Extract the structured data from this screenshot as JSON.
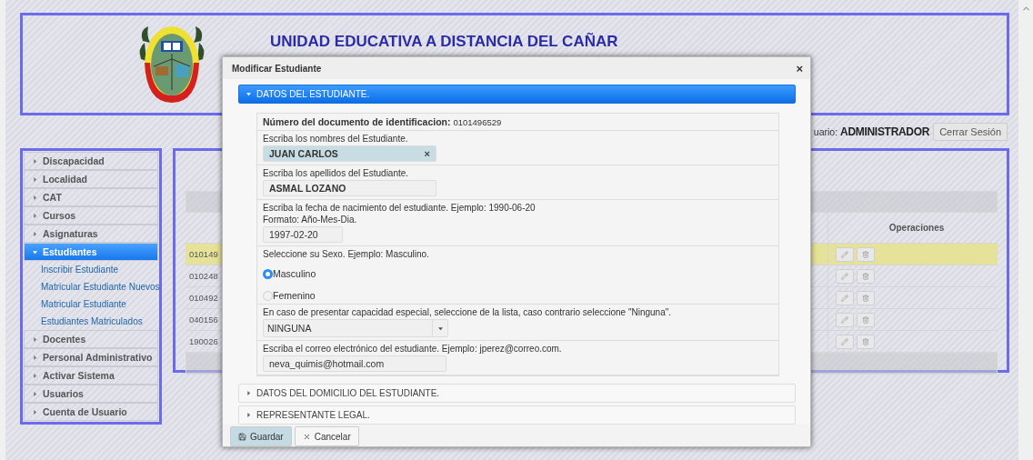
{
  "header": {
    "title": "UNIDAD EDUCATIVA A DISTANCIA DEL CAÑAR"
  },
  "user_bar": {
    "label": "uario:",
    "user": "ADMINISTRADOR",
    "logout": "Cerrar Sesión"
  },
  "sidebar": {
    "items": [
      {
        "label": "Discapacidad",
        "expanded": false,
        "selected": false
      },
      {
        "label": "Localidad",
        "expanded": false,
        "selected": false
      },
      {
        "label": "CAT",
        "expanded": false,
        "selected": false
      },
      {
        "label": "Cursos",
        "expanded": false,
        "selected": false
      },
      {
        "label": "Asignaturas",
        "expanded": false,
        "selected": false
      },
      {
        "label": "Estudiantes",
        "expanded": true,
        "selected": true,
        "children": [
          {
            "label": "Inscribir Estudiante"
          },
          {
            "label": "Matricular Estudiante Nuevos"
          },
          {
            "label": "Matricular Estudiante"
          },
          {
            "label": "Estudiantes Matriculados"
          }
        ]
      },
      {
        "label": "Docentes",
        "expanded": false,
        "selected": false
      },
      {
        "label": "Personal Administrativo",
        "expanded": false,
        "selected": false
      },
      {
        "label": "Activar Sistema",
        "expanded": false,
        "selected": false
      },
      {
        "label": "Usuarios",
        "expanded": false,
        "selected": false
      },
      {
        "label": "Cuenta de Usuario",
        "expanded": false,
        "selected": false
      }
    ]
  },
  "table": {
    "operations_header": "Operaciones",
    "rows": [
      {
        "column_1": "010149",
        "selected": true
      },
      {
        "column_1": "010248",
        "selected": false
      },
      {
        "column_1": "010492",
        "selected": false
      },
      {
        "column_1": "040156",
        "selected": false
      },
      {
        "column_1": "190026",
        "selected": false
      }
    ]
  },
  "dialog": {
    "title": "Modificar Estudiante",
    "close": "×",
    "sections": [
      {
        "title": "DATOS DEL ESTUDIANTE.",
        "expanded": true,
        "fields": [
          {
            "kind": "static",
            "label": "Número del documento de identificacion:",
            "value": "0101496529"
          },
          {
            "kind": "text",
            "label": "Escriba los nombres del Estudiante.",
            "value": "JUAN CARLOS",
            "focused": true,
            "clear": "×"
          },
          {
            "kind": "text",
            "label": "Escriba los apellidos del Estudiante.",
            "value": "ASMAL LOZANO",
            "focused": false
          },
          {
            "kind": "date",
            "label": "Escriba la fecha de nacimiento del estudiante. Ejemplo: 1990-06-20",
            "hint": "Formato: Año-Mes-Dia.",
            "value": "1997-02-20"
          },
          {
            "kind": "radio",
            "label": "Seleccione su Sexo. Ejemplo: Masculino.",
            "options": [
              {
                "label": "Masculino",
                "selected": true
              },
              {
                "label": "Femenino",
                "selected": false
              }
            ]
          },
          {
            "kind": "select",
            "label": "En caso de presentar capacidad especial, seleccione de la lista, caso contrario seleccione \"Ninguna\".",
            "value": "NINGUNA"
          },
          {
            "kind": "email",
            "label": "Escriba el correo electrónico del estudiante. Ejemplo: jperez@correo.com.",
            "value": "neva_quimis@hotmail.com"
          }
        ]
      },
      {
        "title": "DATOS DEL DOMICILIO DEL ESTUDIANTE.",
        "expanded": false
      },
      {
        "title": "REPRESENTANTE LEGAL.",
        "expanded": false
      }
    ],
    "buttons": [
      {
        "kind": "save",
        "label": "Guardar"
      },
      {
        "kind": "cancel",
        "label": "Cancelar"
      }
    ]
  }
}
